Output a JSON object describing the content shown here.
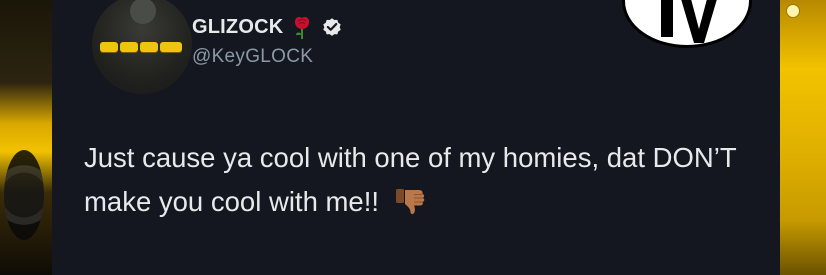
{
  "tweet": {
    "display_name": "GLIZOCK",
    "handle": "@KeyGLOCK",
    "text": "Just cause ya cool with one of my homies, dat DON’T make you cool with me!!",
    "emoji_after_name": "rose-icon",
    "verified_badge": "verified-icon",
    "emoji_after_text": "thumbs-down-icon"
  },
  "colors": {
    "card_background": "#14171f",
    "text_primary": "#e7e9ea",
    "text_secondary": "#8b98a5",
    "accent_yellow": "#f2c200"
  }
}
